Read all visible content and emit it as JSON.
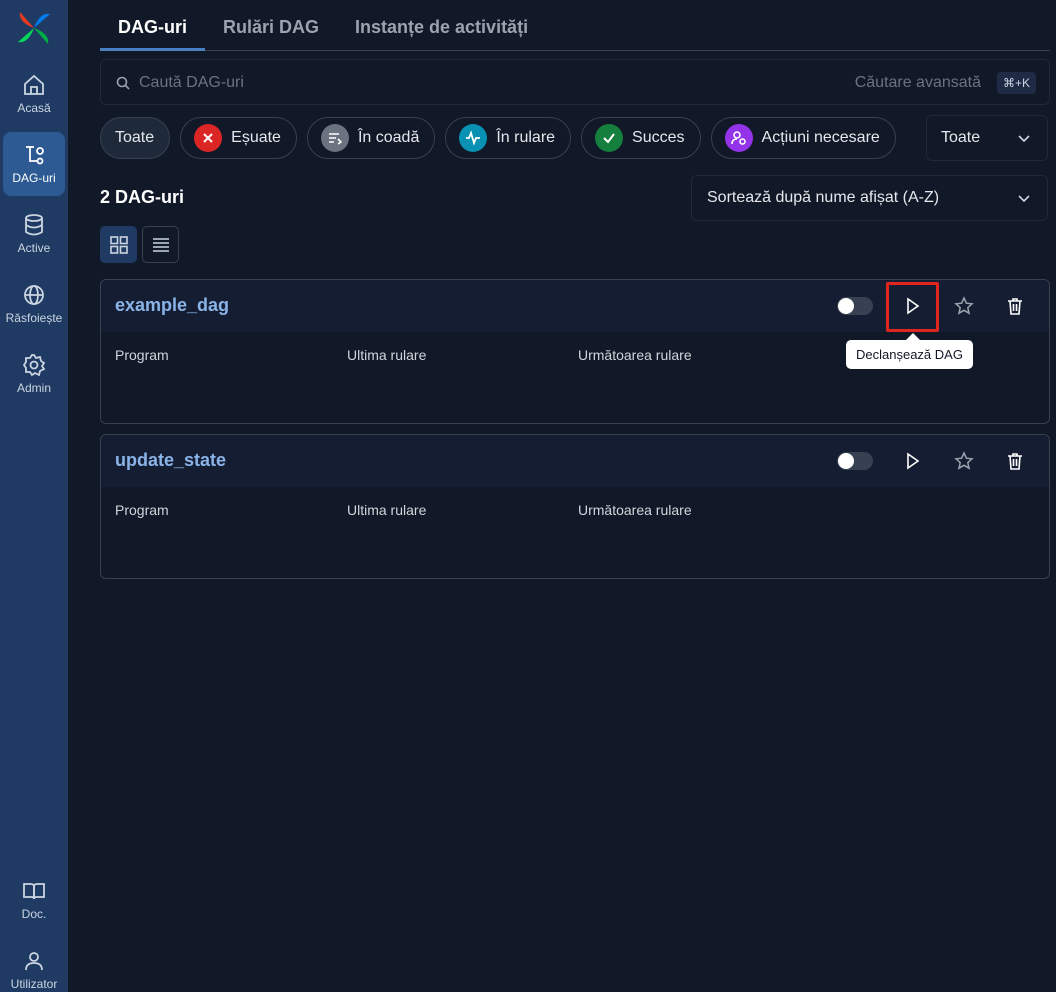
{
  "sidebar": {
    "items": [
      {
        "label": "Acasă",
        "icon": "home-icon"
      },
      {
        "label": "DAG-uri",
        "icon": "dag-icon",
        "active": true
      },
      {
        "label": "Active",
        "icon": "database-icon"
      },
      {
        "label": "Răsfoiește",
        "icon": "globe-icon"
      },
      {
        "label": "Admin",
        "icon": "gear-icon"
      }
    ],
    "bottom": [
      {
        "label": "Doc.",
        "icon": "book-icon"
      },
      {
        "label": "Utilizator",
        "icon": "user-icon"
      }
    ]
  },
  "tabs": [
    {
      "label": "DAG-uri",
      "active": true
    },
    {
      "label": "Rulări DAG"
    },
    {
      "label": "Instanțe de activități"
    }
  ],
  "search": {
    "placeholder": "Caută DAG-uri",
    "advanced_label": "Căutare avansată",
    "shortcut": "⌘+K"
  },
  "filters": {
    "chips": [
      {
        "label": "Toate",
        "active": true
      },
      {
        "label": "Eșuate",
        "icon": "close-icon",
        "color": "#dc2626"
      },
      {
        "label": "În coadă",
        "icon": "queue-icon",
        "color": "#6b7280"
      },
      {
        "label": "În rulare",
        "icon": "activity-icon",
        "color": "#0891b2"
      },
      {
        "label": "Succes",
        "icon": "check-icon",
        "color": "#15803d"
      },
      {
        "label": "Acțiuni necesare",
        "icon": "user-action-icon",
        "color": "#9333ea"
      }
    ],
    "status_select": "Toate"
  },
  "count_label": "2 DAG-uri",
  "sort_label": "Sortează după nume afișat (A-Z)",
  "columns": {
    "schedule": "Program",
    "last_run": "Ultima rulare",
    "next_run": "Următoarea rulare"
  },
  "dags": [
    {
      "name": "example_dag"
    },
    {
      "name": "update_state"
    }
  ],
  "tooltip": "Declanșează DAG",
  "colors": {
    "sidebar": "#1f3a63",
    "background": "#111827",
    "dag_name": "#8ab4e8",
    "highlight": "#e0261f"
  }
}
